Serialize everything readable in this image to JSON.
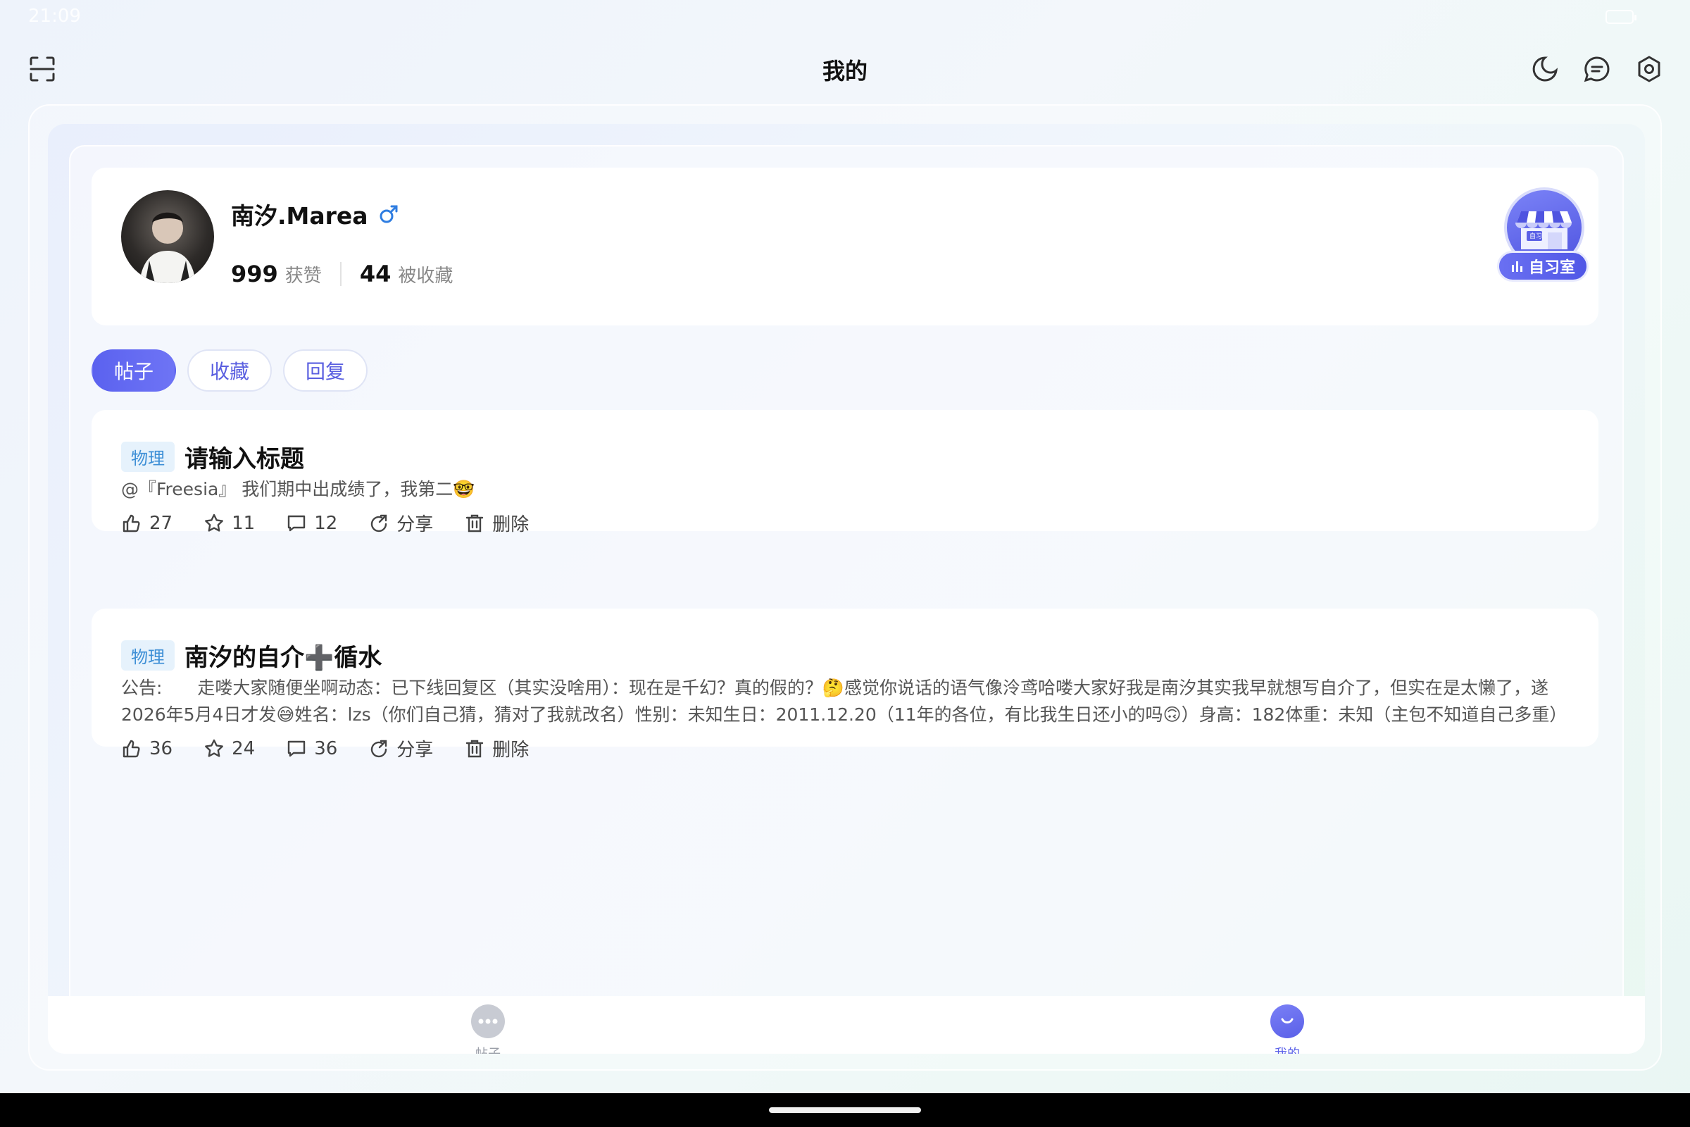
{
  "status_bar": {
    "time": "21:09"
  },
  "header": {
    "title": "我的"
  },
  "profile": {
    "name": "南汐.Marea",
    "likes_count": "999",
    "likes_label": "获赞",
    "favorites_count": "44",
    "favorites_label": "被收藏"
  },
  "study_room": {
    "label": "自习室",
    "sign_text": "自习"
  },
  "tabs": [
    {
      "label": "帖子",
      "active": true
    },
    {
      "label": "收藏",
      "active": false
    },
    {
      "label": "回复",
      "active": false
    }
  ],
  "posts": [
    {
      "tag": "物理",
      "title": "请输入标题",
      "body": "@『Freesia』 我们期中出成绩了，我第二🤓",
      "likes": "27",
      "favorites": "11",
      "comments": "12",
      "share_label": "分享",
      "delete_label": "删除"
    },
    {
      "tag": "物理",
      "title": "南汐的自介➕循水",
      "body": "公告:　　走喽大家随便坐啊动态：已下线回复区（其实没啥用）：现在是千幻？真的假的？🤔感觉你说话的语气像泠鸢哈喽大家好我是南汐其实我早就想写自介了，但实在是太懒了，遂2026年5月4日才发😅姓名：lzs（你们自己猜，猜对了我就改名）性别：未知生日：2011.12.20（11年的各位，有比我生日还小的吗🙃）身高：182体重：未知（主包不知道自己多重）",
      "likes": "36",
      "favorites": "24",
      "comments": "36",
      "share_label": "分享",
      "delete_label": "删除"
    }
  ],
  "bottom_nav": [
    {
      "label": "帖子",
      "active": false
    },
    {
      "label": "我的",
      "active": true
    }
  ],
  "colors": {
    "accent": "#5b62ef",
    "tag_text": "#3d8fd6",
    "tag_bg": "#e6f2fc",
    "gender_male": "#2f7de1"
  }
}
